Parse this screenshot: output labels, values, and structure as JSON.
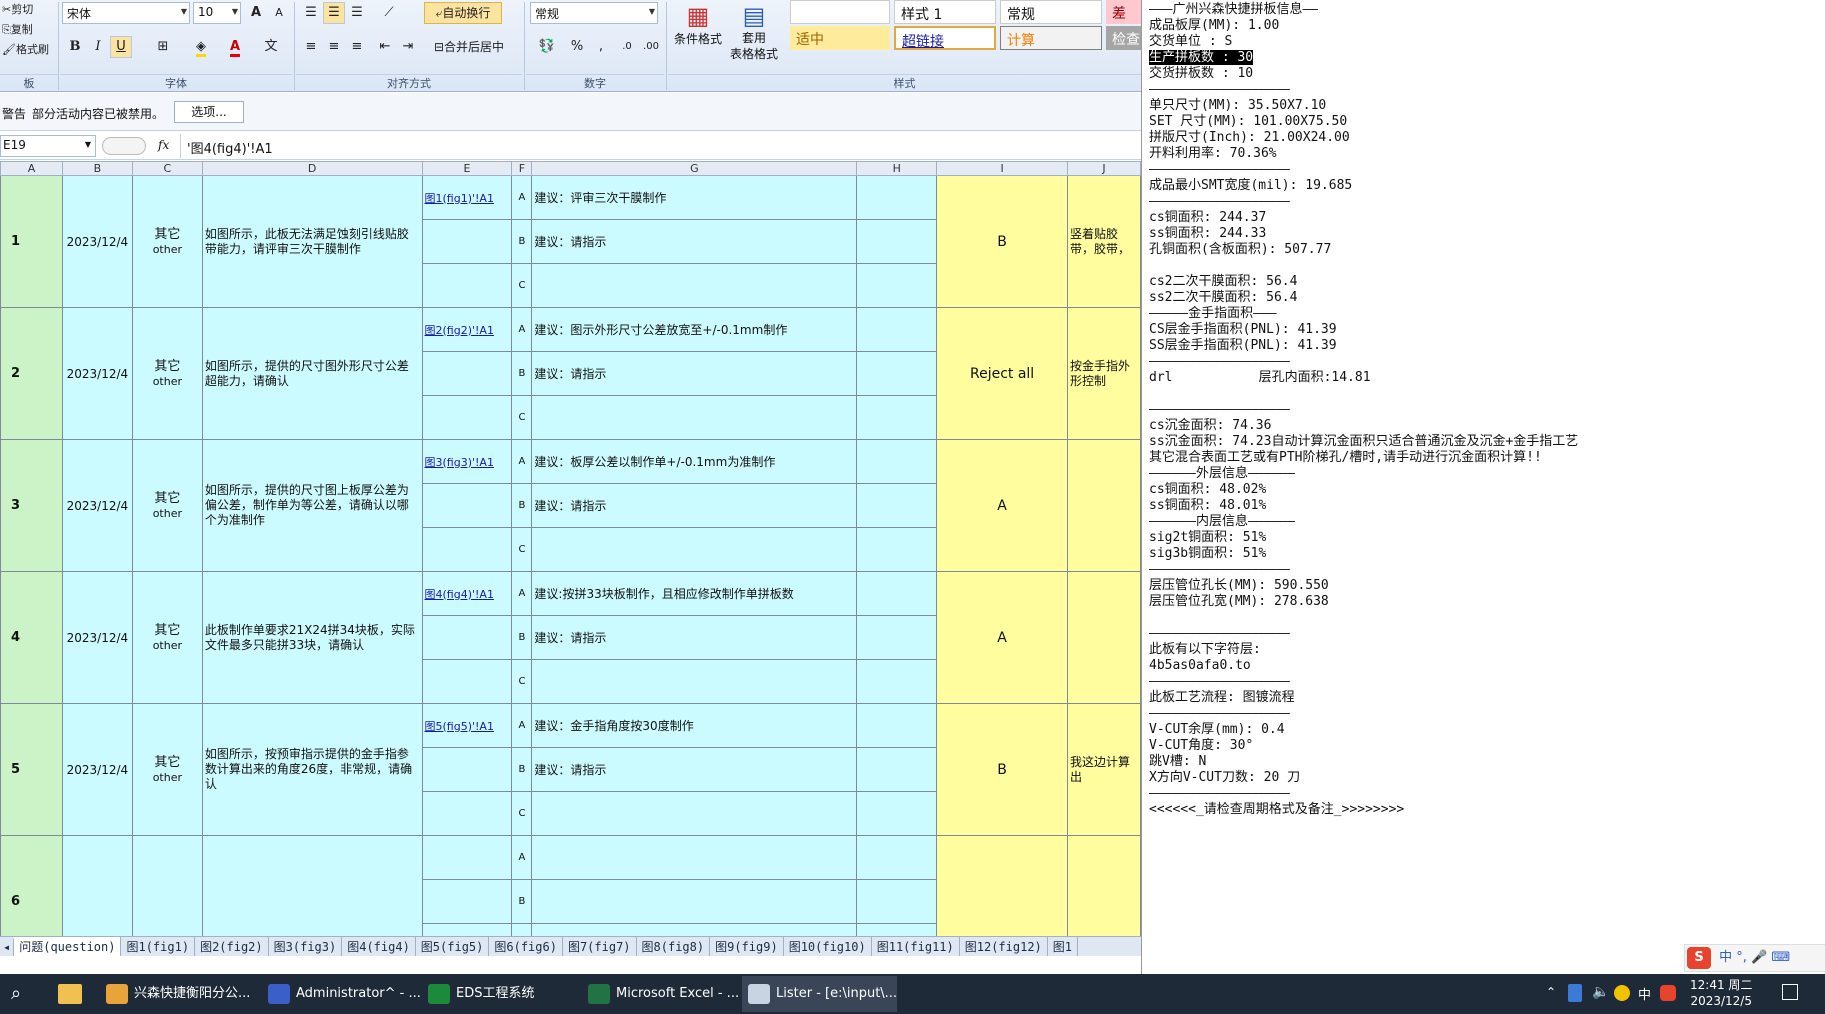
{
  "ribbon": {
    "clipboard": {
      "cut": "剪切",
      "copy": "复制",
      "format_painter": "格式刷",
      "group": "板"
    },
    "font": {
      "name": "宋体",
      "size": "10",
      "bold": "B",
      "italic": "I",
      "underline": "U",
      "grow": "A",
      "shrink": "A",
      "group": "字体"
    },
    "alignment": {
      "wrap_text": "自动换行",
      "merge_center": "合并后居中",
      "group": "对齐方式"
    },
    "number": {
      "format": "常规",
      "group": "数字"
    },
    "styles": {
      "conditional_format": "条件格式",
      "table_format_1": "套用",
      "table_format_2": "表格格式",
      "style1": "样式 1",
      "normal": "常规",
      "bad": "差",
      "neutral": "适中",
      "hyperlink": "超链接",
      "calc": "计算",
      "check": "检查",
      "group": "样式"
    }
  },
  "msgbar": {
    "warning": "警告",
    "text": "部分活动内容已被禁用。",
    "options": "选项..."
  },
  "formula_bar": {
    "cell_ref": "E19",
    "fx": "fx",
    "formula": "'图4(fig4)'!A1"
  },
  "columns": [
    "A",
    "B",
    "C",
    "D",
    "E",
    "F",
    "G",
    "H",
    "I",
    "J"
  ],
  "rows": [
    {
      "no": "1",
      "date": "2023/12/4",
      "cat_cn": "其它",
      "cat_en": "other",
      "desc": "如图所示，此板无法满足蚀刻引线贴胶带能力，请评审三次干膜制作",
      "link": "图1(fig1)'!A1",
      "opt_a": "建议：评审三次干膜制作",
      "opt_b": "建议：请指示",
      "opt_c": "",
      "answer": "B",
      "note": "竖着贴胶带，胶带，"
    },
    {
      "no": "2",
      "date": "2023/12/4",
      "cat_cn": "其它",
      "cat_en": "other",
      "desc": "如图所示，提供的尺寸图外形尺寸公差超能力，请确认",
      "link": "图2(fig2)'!A1",
      "opt_a": "建议：图示外形尺寸公差放宽至+/-0.1mm制作",
      "opt_b": "建议：请指示",
      "opt_c": "",
      "answer": "Reject all",
      "note": "按金手指外形控制"
    },
    {
      "no": "3",
      "date": "2023/12/4",
      "cat_cn": "其它",
      "cat_en": "other",
      "desc": "如图所示，提供的尺寸图上板厚公差为偏公差，制作单为等公差，请确认以哪个为准制作",
      "link": "图3(fig3)'!A1",
      "opt_a": "建议：板厚公差以制作单+/-0.1mm为准制作",
      "opt_b": "建议：请指示",
      "opt_c": "",
      "answer": "A",
      "note": ""
    },
    {
      "no": "4",
      "date": "2023/12/4",
      "cat_cn": "其它",
      "cat_en": "other",
      "desc": "此板制作单要求21X24拼34块板，实际文件最多只能拼33块，请确认",
      "link": "图4(fig4)'!A1",
      "opt_a": "建议:按拼33块板制作，且相应修改制作单拼板数",
      "opt_b": "建议：请指示",
      "opt_c": "",
      "answer": "A",
      "note": ""
    },
    {
      "no": "5",
      "date": "2023/12/4",
      "cat_cn": "其它",
      "cat_en": "other",
      "desc": "如图所示，按预审指示提供的金手指参数计算出来的角度26度，非常规，请确认",
      "link": "图5(fig5)'!A1",
      "opt_a": "建议：金手指角度按30度制作",
      "opt_b": "建议：请指示",
      "opt_c": "",
      "answer": "B",
      "note": "我这边计算出"
    },
    {
      "no": "6",
      "date": "",
      "cat_cn": "",
      "cat_en": "",
      "desc": "",
      "link": "",
      "opt_a": "",
      "opt_b": "",
      "opt_c": "",
      "answer": "",
      "note": ""
    }
  ],
  "option_letters": [
    "A",
    "B",
    "C"
  ],
  "sheet_tabs": [
    "问题(question)",
    "图1(fig1)",
    "图2(fig2)",
    "图3(fig3)",
    "图4(fig4)",
    "图5(fig5)",
    "图6(fig6)",
    "图7(fig7)",
    "图8(fig8)",
    "图9(fig9)",
    "图10(fig10)",
    "图11(fig11)",
    "图12(fig12)",
    "图1"
  ],
  "lister": {
    "lines": [
      "———广州兴森快捷拼板信息——",
      "成品板厚(MM): 1.00",
      "交货单位 : S",
      "生产拼板数 : 30",
      "交货拼板数 : 10",
      "——————————————————",
      "单只尺寸(MM): 35.50X7.10",
      "SET 尺寸(MM): 101.00X75.50",
      "拼版尺寸(Inch): 21.00X24.00",
      "开料利用率: 70.36%",
      "——————————————————",
      "成品最小SMT宽度(mil): 19.685",
      "——————————————————",
      "cs铜面积: 244.37",
      "ss铜面积: 244.33",
      "孔铜面积(含板面积): 507.77",
      "",
      "cs2二次干膜面积: 56.4",
      "ss2二次干膜面积: 56.4",
      "—————金手指面积———",
      "CS层金手指面积(PNL): 41.39",
      "SS层金手指面积(PNL): 41.39",
      "——————————————————",
      "drl           层孔内面积:14.81",
      "",
      "——————————————————",
      "cs沉金面积: 74.36",
      "ss沉金面积: 74.23自动计算沉金面积只适合普通沉金及沉金+金手指工艺",
      "其它混合表面工艺或有PTH阶梯孔/槽时,请手动进行沉金面积计算!!",
      "——————外层信息——————",
      "cs铜面积: 48.02%",
      "ss铜面积: 48.01%",
      "——————内层信息——————",
      "sig2t铜面积: 51%",
      "sig3b铜面积: 51%",
      "——————————————————",
      "层压管位孔长(MM): 590.550",
      "层压管位孔宽(MM): 278.638",
      "",
      "——————————————————",
      "此板有以下字符层:",
      "4b5as0afa0.to",
      "——————————————————",
      "此板工艺流程: 图镀流程",
      "——————————————————",
      "V-CUT余厚(mm): 0.4",
      "V-CUT角度: 30°",
      "跳V槽: N",
      "X方向V-CUT刀数: 20 刀",
      "——————————————————",
      "<<<<<<_请检查周期格式及备注_>>>>>>>>"
    ],
    "ime": [
      "中",
      "°,",
      "🎤",
      "⌨"
    ]
  },
  "taskbar": {
    "items": [
      {
        "label": "兴森快捷衡阳分公...",
        "color": "#e8a33a"
      },
      {
        "label": "Administrator^ - ...",
        "color": "#3a5fc8"
      },
      {
        "label": "EDS工程系统",
        "color": "#1b8a3a"
      },
      {
        "label": "Microsoft Excel - ...",
        "color": "#217346"
      },
      {
        "label": "Lister - [e:\\input\\...",
        "color": "#c9d4e2"
      }
    ],
    "tray_lang": "中",
    "time": "12:41 周二",
    "date": "2023/12/5"
  },
  "colors": {
    "green": "#ccf2c8",
    "cyan": "#ccfbff",
    "yellow": "#fffd9e",
    "ribbon": "#dbe6f5"
  }
}
